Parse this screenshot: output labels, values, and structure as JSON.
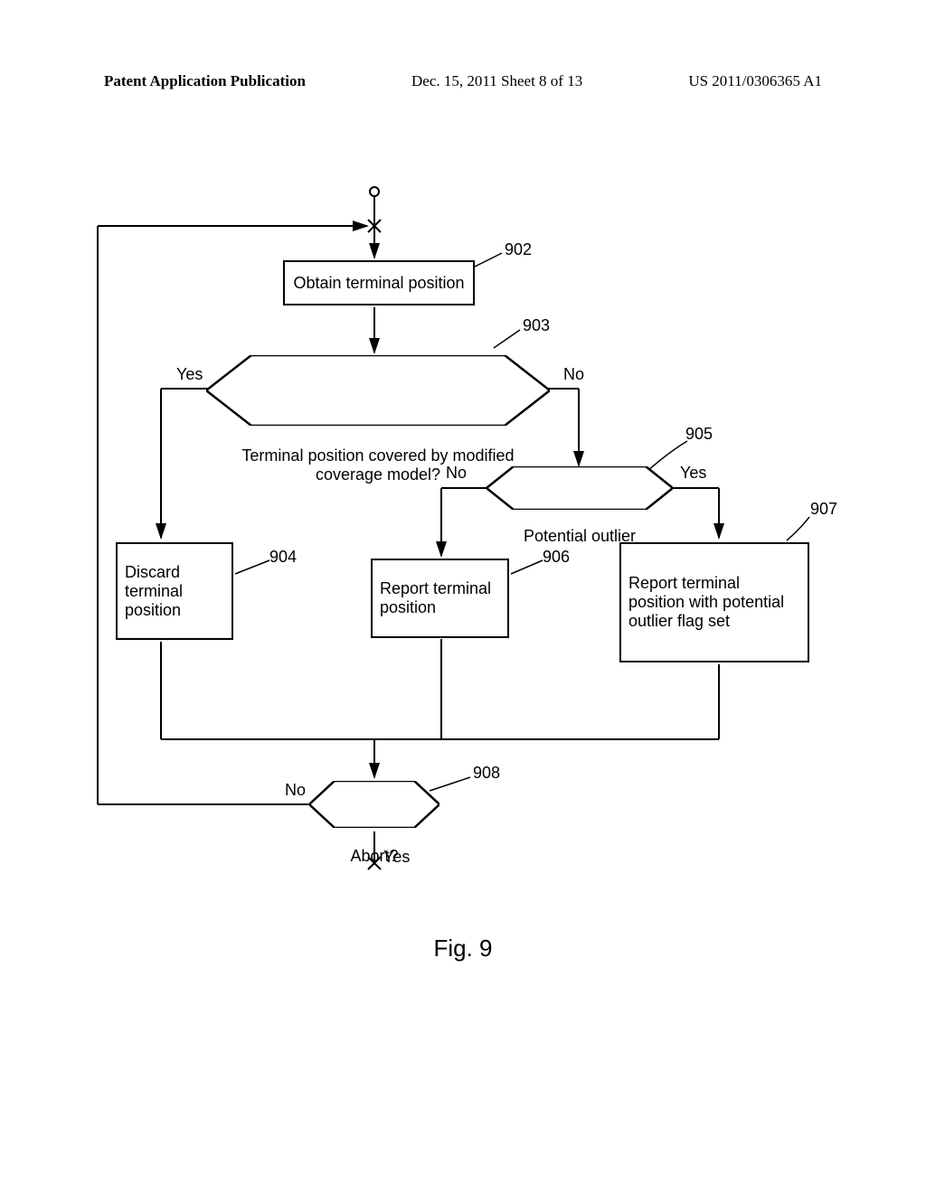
{
  "header": {
    "left": "Patent Application Publication",
    "center": "Dec. 15, 2011  Sheet 8 of 13",
    "right": "US 2011/0306365 A1"
  },
  "steps": {
    "s902": "Obtain terminal position",
    "s903": "Terminal position covered by modified coverage model?",
    "s904": "Discard terminal position",
    "s905": "Potential outlier",
    "s906": "Report terminal position",
    "s907": "Report terminal position with potential outlier flag set",
    "s908": "Abort?"
  },
  "refs": {
    "r902": "902",
    "r903": "903",
    "r904": "904",
    "r905": "905",
    "r906": "906",
    "r907": "907",
    "r908": "908"
  },
  "edges": {
    "yes": "Yes",
    "no": "No"
  },
  "caption": "Fig. 9"
}
